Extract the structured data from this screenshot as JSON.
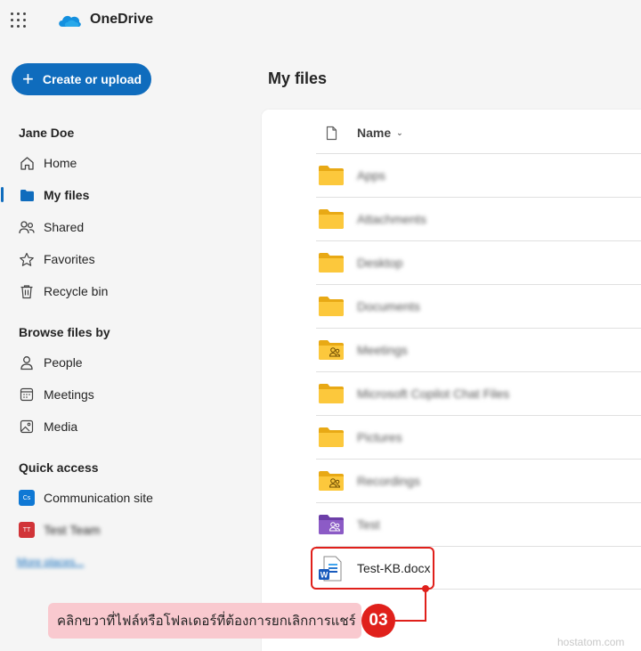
{
  "app": {
    "brand": "OneDrive"
  },
  "sidebar": {
    "create_label": "Create or upload",
    "user_name": "Jane Doe",
    "main_nav": [
      {
        "label": "Home",
        "icon": "home-icon"
      },
      {
        "label": "My files",
        "icon": "folder-icon",
        "active": true
      },
      {
        "label": "Shared",
        "icon": "people-icon"
      },
      {
        "label": "Favorites",
        "icon": "star-icon"
      },
      {
        "label": "Recycle bin",
        "icon": "trash-icon"
      }
    ],
    "browse_title": "Browse files by",
    "browse_nav": [
      {
        "label": "People",
        "icon": "person-icon"
      },
      {
        "label": "Meetings",
        "icon": "calendar-icon"
      },
      {
        "label": "Media",
        "icon": "image-icon"
      }
    ],
    "quick_title": "Quick access",
    "quick_nav": [
      {
        "label": "Communication site",
        "badge": "Cs",
        "color": "#0f78d4"
      },
      {
        "label": "Test Team",
        "badge": "TT",
        "color": "#d13438"
      }
    ],
    "more_places": "More places..."
  },
  "main": {
    "title": "My files",
    "column_name": "Name",
    "files": [
      {
        "name": "Apps",
        "type": "folder"
      },
      {
        "name": "Attachments",
        "type": "folder"
      },
      {
        "name": "Desktop",
        "type": "folder"
      },
      {
        "name": "Documents",
        "type": "folder"
      },
      {
        "name": "Meetings",
        "type": "shared-folder"
      },
      {
        "name": "Microsoft Copilot Chat Files",
        "type": "folder"
      },
      {
        "name": "Pictures",
        "type": "folder"
      },
      {
        "name": "Recordings",
        "type": "shared-folder"
      },
      {
        "name": "Test",
        "type": "team-folder"
      },
      {
        "name": "Test-KB.docx",
        "type": "word"
      }
    ]
  },
  "annotation": {
    "instruction": "คลิกขวาที่ไฟล์หรือโฟลเดอร์ที่ต้องการยกเลิกการแชร์",
    "step": "03"
  },
  "watermark": "hostatom.com",
  "colors": {
    "accent": "#0f6cbd",
    "folder": "#f4c33a",
    "team_folder": "#8c5bc6",
    "annotation_red": "#e0201b",
    "callout_bg": "#f9c9cf"
  }
}
